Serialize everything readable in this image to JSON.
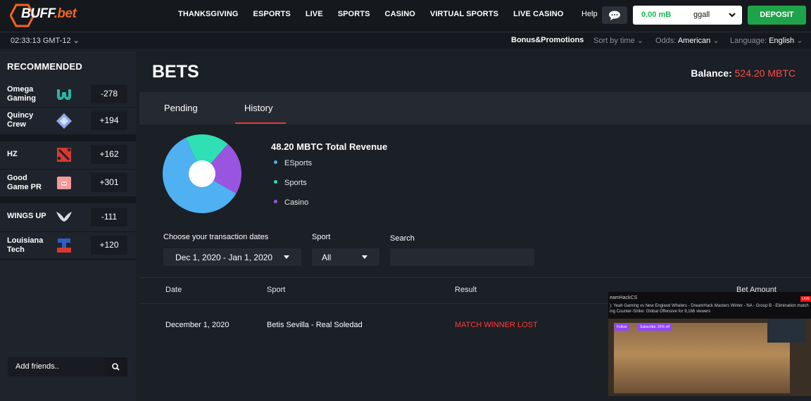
{
  "brand": {
    "logo_text": "BUFF",
    "logo_suffix": ".bet"
  },
  "nav": [
    "THANKSGIVING",
    "ESPORTS",
    "LIVE",
    "SPORTS",
    "CASINO",
    "VIRTUAL SPORTS",
    "LIVE CASINO"
  ],
  "header": {
    "help": "Help",
    "wallet_balance": "0.00 mB",
    "username": "ggall",
    "deposit": "DEPOSIT"
  },
  "subbar": {
    "clock": "02:33:13 GMT-12",
    "bonus": "Bonus&Promotions",
    "sort": "Sort by time",
    "odds_label": "Odds:",
    "odds_value": "American",
    "lang_label": "Language:",
    "lang_value": "English"
  },
  "sidebar": {
    "title": "RECOMMENDED",
    "teams": [
      {
        "name": "Omega Gaming",
        "odds": "-278",
        "icon": "omega-icon",
        "color": "#2bb5a5"
      },
      {
        "name": "Quincy Crew",
        "odds": "+194",
        "icon": "quincy-icon",
        "color": "#8ea9e8"
      },
      {
        "name": "HZ",
        "odds": "+162",
        "icon": "dota-icon",
        "color": "#d9382f"
      },
      {
        "name": "Good Game PR",
        "odds": "+301",
        "icon": "pig-icon",
        "color": "#f19a9a"
      },
      {
        "name": "WINGS UP",
        "odds": "-111",
        "icon": "wings-icon",
        "color": "#d7dee6"
      },
      {
        "name": "Louisiana Tech",
        "odds": "+120",
        "icon": "latech-icon",
        "color": "#2e5ec4"
      }
    ],
    "friends_placeholder": "Add friends.."
  },
  "main": {
    "title": "BETS",
    "balance_label": "Balance:",
    "balance_value": "524.20 MBTC",
    "tabs": [
      "Pending",
      "History"
    ],
    "active_tab": "History",
    "revenue": "48.20 MBTC Total Revenue",
    "filters": {
      "dates_label": "Choose your transaction dates",
      "dates_value": "Dec 1, 2020 - Jan 1, 2020",
      "sport_label": "Sport",
      "sport_value": "All",
      "search_label": "Search"
    },
    "table": {
      "headers": [
        "Date",
        "Sport",
        "Result",
        "Bet Amount"
      ],
      "rows": [
        {
          "date": "December 1, 2020",
          "sport": "Betis Sevilla - Real Soledad",
          "result": "MATCH WINNER LOST"
        }
      ]
    }
  },
  "chart_data": {
    "type": "pie",
    "categories": [
      "ESports",
      "Sports",
      "Casino"
    ],
    "values": [
      60,
      18,
      22
    ],
    "colors": [
      "#4fb0f2",
      "#2fe0b4",
      "#9a55e0"
    ]
  },
  "video": {
    "channel": "eamHackCS",
    "title": "): Yeah Gaming vs New England Whalers - DreamHack Masters Winter - NA - Group B - Elimination match",
    "subtitle": "ing Counter-Strike: Global Offensive for 9,166 viewers",
    "follow": "Follow",
    "subscribe": "Subscribe: 20% off",
    "live": "LIVE"
  }
}
